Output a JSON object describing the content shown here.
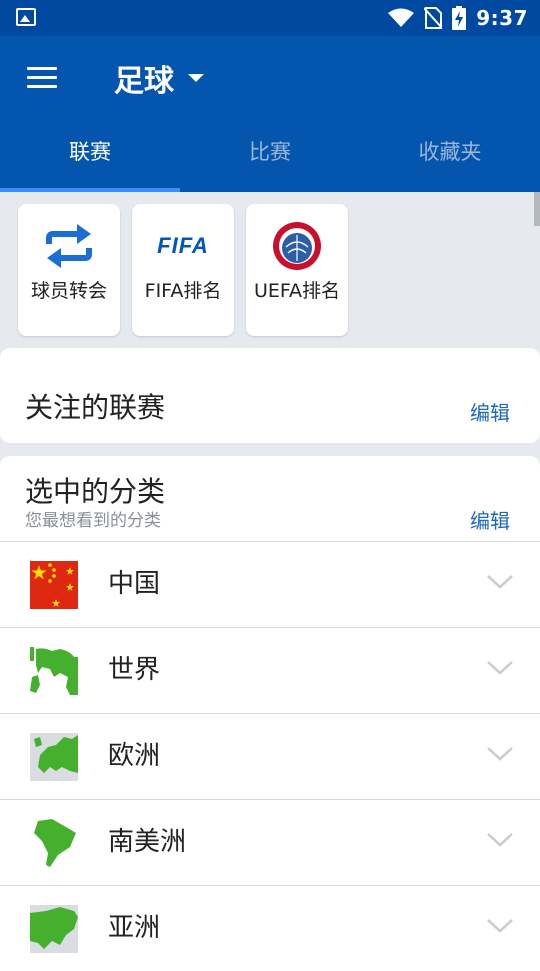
{
  "status_bar": {
    "time": "9:37"
  },
  "app_bar": {
    "title": "足球"
  },
  "tabs": [
    {
      "label": "联赛",
      "active": true
    },
    {
      "label": "比赛",
      "active": false
    },
    {
      "label": "收藏夹",
      "active": false
    }
  ],
  "shortcuts": [
    {
      "label": "球员转会",
      "icon": "transfer-arrows-icon"
    },
    {
      "label": "FIFA排名",
      "icon": "fifa-logo",
      "logo_text": "FIFA"
    },
    {
      "label": "UEFA排名",
      "icon": "uefa-logo"
    }
  ],
  "followed": {
    "title": "关注的联赛",
    "edit_label": "编辑"
  },
  "categories": {
    "title": "选中的分类",
    "subtitle": "您最想看到的分类",
    "edit_label": "编辑",
    "items": [
      {
        "name": "中国",
        "icon": "china-flag-icon"
      },
      {
        "name": "世界",
        "icon": "world-map-icon"
      },
      {
        "name": "欧洲",
        "icon": "europe-map-icon"
      },
      {
        "name": "南美洲",
        "icon": "south-america-map-icon"
      },
      {
        "name": "亚洲",
        "icon": "asia-map-icon"
      }
    ]
  },
  "colors": {
    "app_bar": "#0455ad",
    "status_bar": "#0049a0",
    "tab_indicator": "#3b8ef5",
    "link": "#1d68b7",
    "map_green": "#45b02e"
  }
}
